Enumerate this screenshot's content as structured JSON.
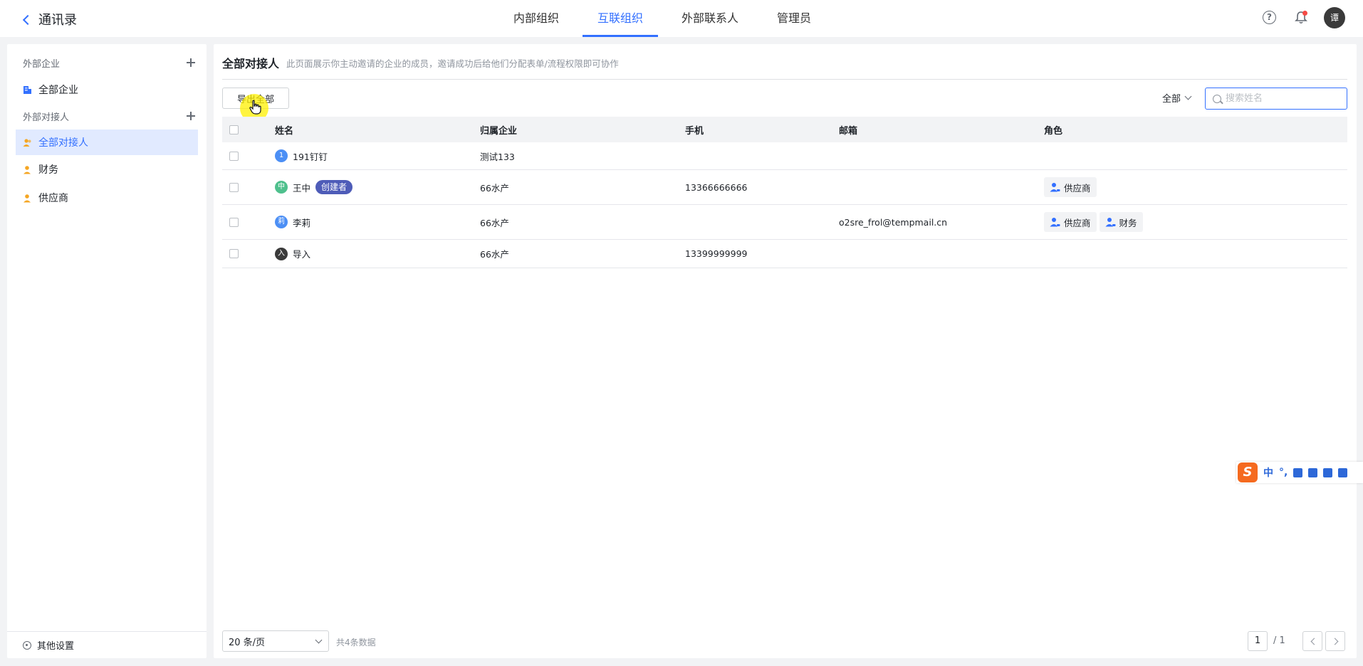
{
  "header": {
    "title": "通讯录",
    "tabs": [
      {
        "label": "内部组织",
        "active": false
      },
      {
        "label": "互联组织",
        "active": true
      },
      {
        "label": "外部联系人",
        "active": false
      },
      {
        "label": "管理员",
        "active": false
      }
    ],
    "help_glyph": "?",
    "avatar_text": "谭"
  },
  "sidebar": {
    "section_companies": "外部企业",
    "all_companies": "全部企业",
    "section_contacts": "外部对接人",
    "items": [
      {
        "label": "全部对接人",
        "active": true
      },
      {
        "label": "财务",
        "active": false
      },
      {
        "label": "供应商",
        "active": false
      }
    ],
    "settings": "其他设置"
  },
  "main": {
    "title": "全部对接人",
    "description": "此页面展示你主动邀请的企业的成员，邀请成功后给他们分配表单/流程权限即可协作",
    "export_label": "导出全部",
    "filter_label": "全部",
    "search_placeholder": "搜索姓名"
  },
  "table": {
    "columns": [
      "姓名",
      "归属企业",
      "手机",
      "邮箱",
      "角色"
    ],
    "rows": [
      {
        "avatar": "1",
        "avatar_color": "#4c8ff5",
        "name": "191钉钉",
        "creator": "",
        "company": "测试133",
        "phone": "",
        "email": "",
        "roles": []
      },
      {
        "avatar": "中",
        "avatar_color": "#4fc08d",
        "name": "王中",
        "creator": "创建者",
        "company": "66水产",
        "phone": "13366666666",
        "email": "",
        "roles": [
          "供应商"
        ]
      },
      {
        "avatar": "莉",
        "avatar_color": "#4c8ff5",
        "name": "李莉",
        "creator": "",
        "company": "66水产",
        "phone": "",
        "email": "o2sre_frol@tempmail.cn",
        "roles": [
          "供应商",
          "财务"
        ]
      },
      {
        "avatar": "入",
        "avatar_color": "#3a3a3a",
        "name": "导入",
        "creator": "",
        "company": "66水产",
        "phone": "13399999999",
        "email": "",
        "roles": []
      }
    ]
  },
  "pagination": {
    "page_size": "20 条/页",
    "total": "共4条数据",
    "current": "1",
    "total_pages": "/ 1"
  },
  "ime": {
    "logo": "S",
    "mode": "中",
    "punct": "°,"
  },
  "colors": {
    "accent": "#3370ff",
    "creator_tag": "#4e5cb8",
    "highlight": "#fff000"
  }
}
